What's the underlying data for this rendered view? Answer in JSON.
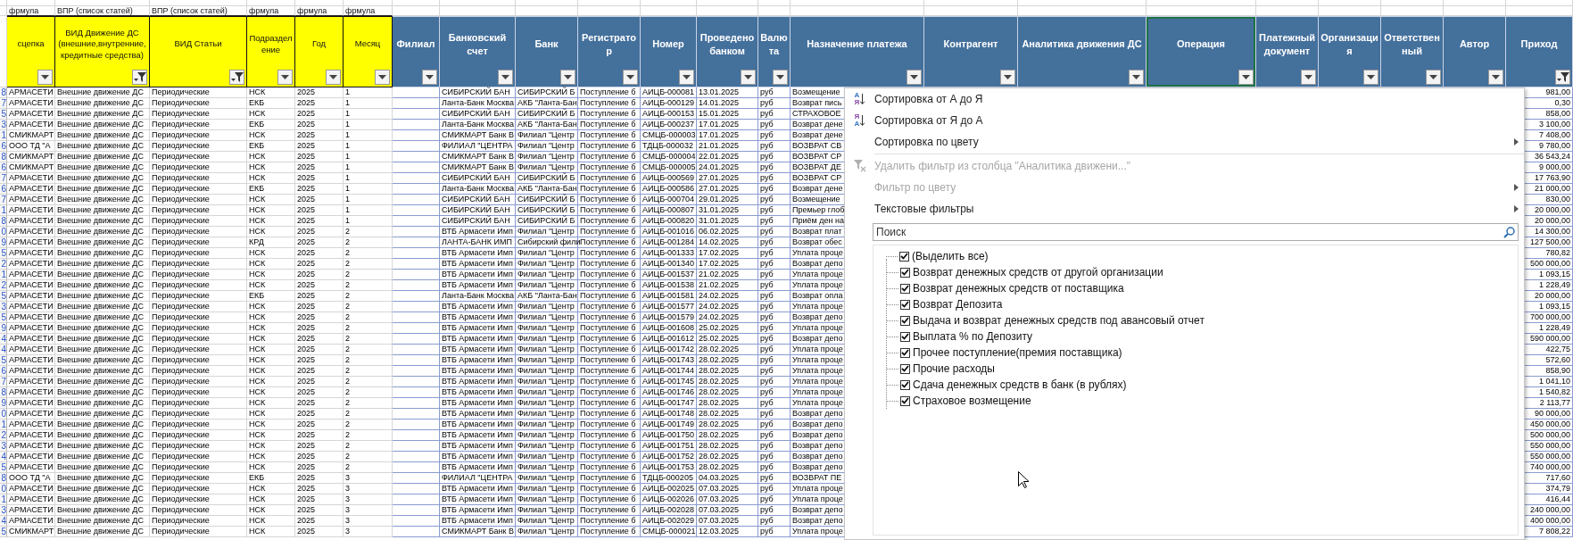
{
  "formula_labels": [
    "фрмула",
    "ВПР (список статей)",
    "ВПР (список статей)",
    "фрмула",
    "фрмула",
    "фрмула"
  ],
  "columns": [
    {
      "header": "сцепка",
      "color": "#ffff00",
      "filtered": false,
      "selected": false
    },
    {
      "header": "ВИД Движение ДС (внешние,внутренние, кредитные средства)",
      "color": "#ffff00",
      "filtered": true,
      "selected": false
    },
    {
      "header": "ВИД Статьи",
      "color": "#ffff00",
      "filtered": true,
      "selected": false
    },
    {
      "header": "Подразделение",
      "color": "#ffff00",
      "filtered": false,
      "selected": false
    },
    {
      "header": "Год",
      "color": "#ffff00",
      "filtered": false,
      "selected": false
    },
    {
      "header": "Месяц",
      "color": "#ffff00",
      "filtered": false,
      "selected": false
    },
    {
      "header": "Филиал",
      "color": "#44709c",
      "filtered": false,
      "selected": false
    },
    {
      "header": "Банковский счет",
      "color": "#44709c",
      "filtered": false,
      "selected": false
    },
    {
      "header": "Банк",
      "color": "#44709c",
      "filtered": false,
      "selected": false
    },
    {
      "header": "Регистратор",
      "color": "#44709c",
      "filtered": false,
      "selected": false
    },
    {
      "header": "Номер",
      "color": "#44709c",
      "filtered": false,
      "selected": false
    },
    {
      "header": "Проведено банком",
      "color": "#44709c",
      "filtered": false,
      "selected": false
    },
    {
      "header": "Валюта",
      "color": "#44709c",
      "filtered": false,
      "selected": false
    },
    {
      "header": "Назначение платежа",
      "color": "#44709c",
      "filtered": false,
      "selected": false
    },
    {
      "header": "Контрагент",
      "color": "#44709c",
      "filtered": false,
      "selected": false
    },
    {
      "header": "Аналитика движения ДС",
      "color": "#44709c",
      "filtered": false,
      "selected": false
    },
    {
      "header": "Операция",
      "color": "#44709c",
      "filtered": false,
      "selected": true
    },
    {
      "header": "Платежный документ",
      "color": "#44709c",
      "filtered": false,
      "selected": false
    },
    {
      "header": "Организация",
      "color": "#44709c",
      "filtered": false,
      "selected": false
    },
    {
      "header": "Ответственный",
      "color": "#44709c",
      "filtered": false,
      "selected": false
    },
    {
      "header": "Автор",
      "color": "#44709c",
      "filtered": false,
      "selected": false
    },
    {
      "header": "Приход",
      "color": "#44709c",
      "filtered": true,
      "selected": false
    }
  ],
  "rows": [
    {
      "row_tail": "8",
      "link": "АРМАСЕТИ",
      "movement_type": "Внешние движение ДС",
      "article_type": "Периодические",
      "division": "НСК",
      "year": "2025",
      "month": "1",
      "bank_account": "СИБИРСКИЙ БАН",
      "bank": "СИБИРСКИЙ Б",
      "registrar": "Поступление б",
      "number": "АИЦБ-000081",
      "bank_date": "13.01.2025",
      "currency": "руб",
      "purpose": "Возмещение",
      "income": "981,00"
    },
    {
      "row_tail": "7",
      "link": "АРМАСЕТИ",
      "movement_type": "Внешние движение ДС",
      "article_type": "Периодические",
      "division": "ЕКБ",
      "year": "2025",
      "month": "1",
      "bank_account": "Ланта-Банк Москва",
      "bank": "АКБ \"Ланта-Бан",
      "registrar": "Поступление б",
      "number": "АИЦБ-000129",
      "bank_date": "14.01.2025",
      "currency": "руб",
      "purpose": "Возврат пись",
      "income": "0,30"
    },
    {
      "row_tail": "5",
      "link": "АРМАСЕТИ",
      "movement_type": "Внешние движение ДС",
      "article_type": "Периодические",
      "division": "НСК",
      "year": "2025",
      "month": "1",
      "bank_account": "СИБИРСКИЙ БАН",
      "bank": "СИБИРСКИЙ Б",
      "registrar": "Поступление б",
      "number": "АИЦБ-000153",
      "bank_date": "15.01.2025",
      "currency": "руб",
      "purpose": "СТРАХОВОЕ",
      "income": "858,00"
    },
    {
      "row_tail": "3",
      "link": "АРМАСЕТИ",
      "movement_type": "Внешние движение ДС",
      "article_type": "Периодические",
      "division": "ЕКБ",
      "year": "2025",
      "month": "1",
      "bank_account": "Ланта-Банк Москва",
      "bank": "АКБ \"Ланта-Бан",
      "registrar": "Поступление б",
      "number": "АИЦБ-000237",
      "bank_date": "17.01.2025",
      "currency": "руб",
      "purpose": "Возврат дене",
      "income": "3 100,00"
    },
    {
      "row_tail": "1",
      "link": "СМИКМАРТ",
      "movement_type": "Внешние движение ДС",
      "article_type": "Периодические",
      "division": "НСК",
      "year": "2025",
      "month": "1",
      "bank_account": "СМИКМАРТ Банк В",
      "bank": "Филиал \"Центр",
      "registrar": "Поступление б",
      "number": "СМЦБ-000003",
      "bank_date": "17.01.2025",
      "currency": "руб",
      "purpose": "Возврат дене",
      "income": "7 408,00"
    },
    {
      "row_tail": "6",
      "link": "ООО ТД \"А",
      "movement_type": "Внешние движение ДС",
      "article_type": "Периодические",
      "division": "ЕКБ",
      "year": "2025",
      "month": "1",
      "bank_account": "ФИЛИАЛ \"ЦЕНТРА",
      "bank": "Филиал \"Центр",
      "registrar": "Поступление б",
      "number": "ТДЦБ-000032",
      "bank_date": "21.01.2025",
      "currency": "руб",
      "purpose": "ВОЗВРАТ СВ",
      "income": "9 780,00"
    },
    {
      "row_tail": "8",
      "link": "СМИКМАРТ",
      "movement_type": "Внешние движение ДС",
      "article_type": "Периодические",
      "division": "НСК",
      "year": "2025",
      "month": "1",
      "bank_account": "СМИКМАРТ Банк В",
      "bank": "Филиал \"Центр",
      "registrar": "Поступление б",
      "number": "СМЦБ-000004",
      "bank_date": "22.01.2025",
      "currency": "руб",
      "purpose": "ВОЗВРАТ СР",
      "income": "36 543,24"
    },
    {
      "row_tail": "6",
      "link": "СМИКМАРТ",
      "movement_type": "Внешние движение ДС",
      "article_type": "Периодические",
      "division": "НСК",
      "year": "2025",
      "month": "1",
      "bank_account": "СМИКМАРТ Банк В",
      "bank": "Филиал \"Центр",
      "registrar": "Поступление б",
      "number": "СМЦБ-000005",
      "bank_date": "24.01.2025",
      "currency": "руб",
      "purpose": "ВОЗВРАТ ДЕ",
      "income": "9 000,00"
    },
    {
      "row_tail": "7",
      "link": "АРМАСЕТИ",
      "movement_type": "Внешние движение ДС",
      "article_type": "Периодические",
      "division": "НСК",
      "year": "2025",
      "month": "1",
      "bank_account": "СИБИРСКИЙ БАН",
      "bank": "СИБИРСКИЙ Б",
      "registrar": "Поступление б",
      "number": "АИЦБ-000569",
      "bank_date": "27.01.2025",
      "currency": "руб",
      "purpose": "ВОЗВРАТ СР",
      "income": "17 763,90"
    },
    {
      "row_tail": "6",
      "link": "АРМАСЕТИ",
      "movement_type": "Внешние движение ДС",
      "article_type": "Периодические",
      "division": "ЕКБ",
      "year": "2025",
      "month": "1",
      "bank_account": "Ланта-Банк Москва",
      "bank": "АКБ \"Ланта-Бан",
      "registrar": "Поступление б",
      "number": "АИЦБ-000586",
      "bank_date": "27.01.2025",
      "currency": "руб",
      "purpose": "Возврат дене",
      "income": "21 000,00"
    },
    {
      "row_tail": "7",
      "link": "АРМАСЕТИ",
      "movement_type": "Внешние движение ДС",
      "article_type": "Периодические",
      "division": "НСК",
      "year": "2025",
      "month": "1",
      "bank_account": "СИБИРСКИЙ БАН",
      "bank": "СИБИРСКИЙ Б",
      "registrar": "Поступление б",
      "number": "АИЦБ-000704",
      "bank_date": "29.01.2025",
      "currency": "руб",
      "purpose": "Возмещение",
      "income": "830,00"
    },
    {
      "row_tail": "1",
      "link": "АРМАСЕТИ",
      "movement_type": "Внешние движение ДС",
      "article_type": "Периодические",
      "division": "НСК",
      "year": "2025",
      "month": "1",
      "bank_account": "СИБИРСКИЙ БАН",
      "bank": "СИБИРСКИЙ Б",
      "registrar": "Поступление б",
      "number": "АИЦБ-000807",
      "bank_date": "31.01.2025",
      "currency": "руб",
      "purpose": "Премьер глоб",
      "income": "20 000,00"
    },
    {
      "row_tail": "8",
      "link": "АРМАСЕТИ",
      "movement_type": "Внешние движение ДС",
      "article_type": "Периодические",
      "division": "НСК",
      "year": "2025",
      "month": "1",
      "bank_account": "СИБИРСКИЙ БАН",
      "bank": "СИБИРСКИЙ Б",
      "registrar": "Поступление б",
      "number": "АИЦБ-000820",
      "bank_date": "31.01.2025",
      "currency": "руб",
      "purpose": "Приём ден на",
      "income": "20 000,00"
    },
    {
      "row_tail": "0",
      "link": "АРМАСЕТИ",
      "movement_type": "Внешние движение ДС",
      "article_type": "Периодические",
      "division": "НСК",
      "year": "2025",
      "month": "2",
      "bank_account": "ВТБ Армасети Имп",
      "bank": "Филиал \"Центр",
      "registrar": "Поступление б",
      "number": "АИЦБ-001016",
      "bank_date": "06.02.2025",
      "currency": "руб",
      "purpose": "Возврат плат",
      "income": "14 300,00"
    },
    {
      "row_tail": "9",
      "link": "АРМАСЕТИ",
      "movement_type": "Внешние движение ДС",
      "article_type": "Периодические",
      "division": "КРД",
      "year": "2025",
      "month": "2",
      "bank_account": "ЛАНТА-БАНК ИМП",
      "bank": "Сибирский фили",
      "registrar": "Поступление б",
      "number": "АИЦБ-001284",
      "bank_date": "14.02.2025",
      "currency": "руб",
      "purpose": "Возврат обес",
      "income": "127 500,00"
    },
    {
      "row_tail": "5",
      "link": "АРМАСЕТИ",
      "movement_type": "Внешние движение ДС",
      "article_type": "Периодические",
      "division": "НСК",
      "year": "2025",
      "month": "2",
      "bank_account": "ВТБ Армасети Имп",
      "bank": "Филиал \"Центр",
      "registrar": "Поступление б",
      "number": "АИЦБ-001333",
      "bank_date": "17.02.2025",
      "currency": "руб",
      "purpose": "Уплата проце",
      "income": "780,82"
    },
    {
      "row_tail": "2",
      "link": "АРМАСЕТИ",
      "movement_type": "Внешние движение ДС",
      "article_type": "Периодические",
      "division": "НСК",
      "year": "2025",
      "month": "2",
      "bank_account": "ВТБ Армасети Имп",
      "bank": "Филиал \"Центр",
      "registrar": "Поступление б",
      "number": "АИЦБ-001340",
      "bank_date": "17.02.2025",
      "currency": "руб",
      "purpose": "Возврат депо",
      "income": "500 000,00"
    },
    {
      "row_tail": "1",
      "link": "АРМАСЕТИ",
      "movement_type": "Внешние движение ДС",
      "article_type": "Периодические",
      "division": "НСК",
      "year": "2025",
      "month": "2",
      "bank_account": "ВТБ Армасети Имп",
      "bank": "Филиал \"Центр",
      "registrar": "Поступление б",
      "number": "АИЦБ-001537",
      "bank_date": "21.02.2025",
      "currency": "руб",
      "purpose": "Уплата проце",
      "income": "1 093,15"
    },
    {
      "row_tail": "2",
      "link": "АРМАСЕТИ",
      "movement_type": "Внешние движение ДС",
      "article_type": "Периодические",
      "division": "НСК",
      "year": "2025",
      "month": "2",
      "bank_account": "ВТБ Армасети Имп",
      "bank": "Филиал \"Центр",
      "registrar": "Поступление б",
      "number": "АИЦБ-001538",
      "bank_date": "21.02.2025",
      "currency": "руб",
      "purpose": "Уплата проце",
      "income": "1 228,49"
    },
    {
      "row_tail": "5",
      "link": "АРМАСЕТИ",
      "movement_type": "Внешние движение ДС",
      "article_type": "Периодические",
      "division": "ЕКБ",
      "year": "2025",
      "month": "2",
      "bank_account": "Ланта-Банк Москва",
      "bank": "АКБ \"Ланта-Бан",
      "registrar": "Поступление б",
      "number": "АИЦБ-001581",
      "bank_date": "24.02.2025",
      "currency": "руб",
      "purpose": "Возврат опла",
      "income": "20 000,00"
    },
    {
      "row_tail": "3",
      "link": "АРМАСЕТИ",
      "movement_type": "Внешние движение ДС",
      "article_type": "Периодические",
      "division": "НСК",
      "year": "2025",
      "month": "2",
      "bank_account": "ВТБ Армасети Имп",
      "bank": "Филиал \"Центр",
      "registrar": "Поступление б",
      "number": "АИЦБ-001577",
      "bank_date": "24.02.2025",
      "currency": "руб",
      "purpose": "Уплата проце",
      "income": "1 093,15"
    },
    {
      "row_tail": "5",
      "link": "АРМАСЕТИ",
      "movement_type": "Внешние движение ДС",
      "article_type": "Периодические",
      "division": "НСК",
      "year": "2025",
      "month": "2",
      "bank_account": "ВТБ Армасети Имп",
      "bank": "Филиал \"Центр",
      "registrar": "Поступление б",
      "number": "АИЦБ-001579",
      "bank_date": "24.02.2025",
      "currency": "руб",
      "purpose": "Возврат депо",
      "income": "700 000,00"
    },
    {
      "row_tail": "9",
      "link": "АРМАСЕТИ",
      "movement_type": "Внешние движение ДС",
      "article_type": "Периодические",
      "division": "НСК",
      "year": "2025",
      "month": "2",
      "bank_account": "ВТБ Армасети Имп",
      "bank": "Филиал \"Центр",
      "registrar": "Поступление б",
      "number": "АИЦБ-001608",
      "bank_date": "25.02.2025",
      "currency": "руб",
      "purpose": "Уплата проце",
      "income": "1 228,49"
    },
    {
      "row_tail": "4",
      "link": "АРМАСЕТИ",
      "movement_type": "Внешние движение ДС",
      "article_type": "Периодические",
      "division": "НСК",
      "year": "2025",
      "month": "2",
      "bank_account": "ВТБ Армасети Имп",
      "bank": "Филиал \"Центр",
      "registrar": "Поступление б",
      "number": "АИЦБ-001612",
      "bank_date": "25.02.2025",
      "currency": "руб",
      "purpose": "Возврат депо",
      "income": "590 000,00"
    },
    {
      "row_tail": "4",
      "link": "АРМАСЕТИ",
      "movement_type": "Внешние движение ДС",
      "article_type": "Периодические",
      "division": "НСК",
      "year": "2025",
      "month": "2",
      "bank_account": "ВТБ Армасети Имп",
      "bank": "Филиал \"Центр",
      "registrar": "Поступление б",
      "number": "АИЦБ-001742",
      "bank_date": "28.02.2025",
      "currency": "руб",
      "purpose": "Уплата проце",
      "income": "422,75"
    },
    {
      "row_tail": "5",
      "link": "АРМАСЕТИ",
      "movement_type": "Внешние движение ДС",
      "article_type": "Периодические",
      "division": "НСК",
      "year": "2025",
      "month": "2",
      "bank_account": "ВТБ Армасети Имп",
      "bank": "Филиал \"Центр",
      "registrar": "Поступление б",
      "number": "АИЦБ-001743",
      "bank_date": "28.02.2025",
      "currency": "руб",
      "purpose": "Уплата проце",
      "income": "572,60"
    },
    {
      "row_tail": "6",
      "link": "АРМАСЕТИ",
      "movement_type": "Внешние движение ДС",
      "article_type": "Периодические",
      "division": "НСК",
      "year": "2025",
      "month": "2",
      "bank_account": "ВТБ Армасети Имп",
      "bank": "Филиал \"Центр",
      "registrar": "Поступление б",
      "number": "АИЦБ-001744",
      "bank_date": "28.02.2025",
      "currency": "руб",
      "purpose": "Уплата проце",
      "income": "858,90"
    },
    {
      "row_tail": "7",
      "link": "АРМАСЕТИ",
      "movement_type": "Внешние движение ДС",
      "article_type": "Периодические",
      "division": "НСК",
      "year": "2025",
      "month": "2",
      "bank_account": "ВТБ Армасети Имп",
      "bank": "Филиал \"Центр",
      "registrar": "Поступление б",
      "number": "АИЦБ-001745",
      "bank_date": "28.02.2025",
      "currency": "руб",
      "purpose": "Уплата проце",
      "income": "1 041,10"
    },
    {
      "row_tail": "8",
      "link": "АРМАСЕТИ",
      "movement_type": "Внешние движение ДС",
      "article_type": "Периодические",
      "division": "НСК",
      "year": "2025",
      "month": "2",
      "bank_account": "ВТБ Армасети Имп",
      "bank": "Филиал \"Центр",
      "registrar": "Поступление б",
      "number": "АИЦБ-001746",
      "bank_date": "28.02.2025",
      "currency": "руб",
      "purpose": "Уплата проце",
      "income": "1 540,82"
    },
    {
      "row_tail": "9",
      "link": "АРМАСЕТИ",
      "movement_type": "Внешние движение ДС",
      "article_type": "Периодические",
      "division": "НСК",
      "year": "2025",
      "month": "2",
      "bank_account": "ВТБ Армасети Имп",
      "bank": "Филиал \"Центр",
      "registrar": "Поступление б",
      "number": "АИЦБ-001747",
      "bank_date": "28.02.2025",
      "currency": "руб",
      "purpose": "Уплата проце",
      "income": "2 113,77"
    },
    {
      "row_tail": "0",
      "link": "АРМАСЕТИ",
      "movement_type": "Внешние движение ДС",
      "article_type": "Периодические",
      "division": "НСК",
      "year": "2025",
      "month": "2",
      "bank_account": "ВТБ Армасети Имп",
      "bank": "Филиал \"Центр",
      "registrar": "Поступление б",
      "number": "АИЦБ-001748",
      "bank_date": "28.02.2025",
      "currency": "руб",
      "purpose": "Возврат депо",
      "income": "90 000,00"
    },
    {
      "row_tail": "1",
      "link": "АРМАСЕТИ",
      "movement_type": "Внешние движение ДС",
      "article_type": "Периодические",
      "division": "НСК",
      "year": "2025",
      "month": "2",
      "bank_account": "ВТБ Армасети Имп",
      "bank": "Филиал \"Центр",
      "registrar": "Поступление б",
      "number": "АИЦБ-001749",
      "bank_date": "28.02.2025",
      "currency": "руб",
      "purpose": "Возврат депо",
      "income": "450 000,00"
    },
    {
      "row_tail": "2",
      "link": "АРМАСЕТИ",
      "movement_type": "Внешние движение ДС",
      "article_type": "Периодические",
      "division": "НСК",
      "year": "2025",
      "month": "2",
      "bank_account": "ВТБ Армасети Имп",
      "bank": "Филиал \"Центр",
      "registrar": "Поступление б",
      "number": "АИЦБ-001750",
      "bank_date": "28.02.2025",
      "currency": "руб",
      "purpose": "Возврат депо",
      "income": "500 000,00"
    },
    {
      "row_tail": "3",
      "link": "АРМАСЕТИ",
      "movement_type": "Внешние движение ДС",
      "article_type": "Периодические",
      "division": "НСК",
      "year": "2025",
      "month": "2",
      "bank_account": "ВТБ Армасети Имп",
      "bank": "Филиал \"Центр",
      "registrar": "Поступление б",
      "number": "АИЦБ-001751",
      "bank_date": "28.02.2025",
      "currency": "руб",
      "purpose": "Возврат депо",
      "income": "550 000,00"
    },
    {
      "row_tail": "4",
      "link": "АРМАСЕТИ",
      "movement_type": "Внешние движение ДС",
      "article_type": "Периодические",
      "division": "НСК",
      "year": "2025",
      "month": "2",
      "bank_account": "ВТБ Армасети Имп",
      "bank": "Филиал \"Центр",
      "registrar": "Поступление б",
      "number": "АИЦБ-001752",
      "bank_date": "28.02.2025",
      "currency": "руб",
      "purpose": "Возврат депо",
      "income": "550 000,00"
    },
    {
      "row_tail": "5",
      "link": "АРМАСЕТИ",
      "movement_type": "Внешние движение ДС",
      "article_type": "Периодические",
      "division": "НСК",
      "year": "2025",
      "month": "2",
      "bank_account": "ВТБ Армасети Имп",
      "bank": "Филиал \"Центр",
      "registrar": "Поступление б",
      "number": "АИЦБ-001753",
      "bank_date": "28.02.2025",
      "currency": "руб",
      "purpose": "Возврат депо",
      "income": "740 000,00"
    },
    {
      "row_tail": "8",
      "link": "ООО ТД \"А",
      "movement_type": "Внешние движение ДС",
      "article_type": "Периодические",
      "division": "ЕКБ",
      "year": "2025",
      "month": "3",
      "bank_account": "ФИЛИАЛ \"ЦЕНТРА",
      "bank": "Филиал \"Центр",
      "registrar": "Поступление б",
      "number": "ТДЦБ-000205",
      "bank_date": "04.03.2025",
      "currency": "руб",
      "purpose": "ВОЗВРАТ ПЕ",
      "income": "717,60"
    },
    {
      "row_tail": "0",
      "link": "АРМАСЕТИ",
      "movement_type": "Внешние движение ДС",
      "article_type": "Периодические",
      "division": "НСК",
      "year": "2025",
      "month": "3",
      "bank_account": "ВТБ Армасети Имп",
      "bank": "Филиал \"Центр",
      "registrar": "Поступление б",
      "number": "АИЦБ-002025",
      "bank_date": "07.03.2025",
      "currency": "руб",
      "purpose": "Уплата проце",
      "income": "374,79"
    },
    {
      "row_tail": "1",
      "link": "АРМАСЕТИ",
      "movement_type": "Внешние движение ДС",
      "article_type": "Периодические",
      "division": "НСК",
      "year": "2025",
      "month": "3",
      "bank_account": "ВТБ Армасети Имп",
      "bank": "Филиал \"Центр",
      "registrar": "Поступление б",
      "number": "АИЦБ-002026",
      "bank_date": "07.03.2025",
      "currency": "руб",
      "purpose": "Уплата проце",
      "income": "416,44"
    },
    {
      "row_tail": "3",
      "link": "АРМАСЕТИ",
      "movement_type": "Внешние движение ДС",
      "article_type": "Периодические",
      "division": "НСК",
      "year": "2025",
      "month": "3",
      "bank_account": "ВТБ Армасети Имп",
      "bank": "Филиал \"Центр",
      "registrar": "Поступление б",
      "number": "АИЦБ-002028",
      "bank_date": "07.03.2025",
      "currency": "руб",
      "purpose": "Возврат депо",
      "income": "240 000,00"
    },
    {
      "row_tail": "4",
      "link": "АРМАСЕТИ",
      "movement_type": "Внешние движение ДС",
      "article_type": "Периодические",
      "division": "НСК",
      "year": "2025",
      "month": "3",
      "bank_account": "ВТБ Армасети Имп",
      "bank": "Филиал \"Центр",
      "registrar": "Поступление б",
      "number": "АИЦБ-002029",
      "bank_date": "07.03.2025",
      "currency": "руб",
      "purpose": "Возврат депо",
      "income": "400 000,00"
    },
    {
      "row_tail": "5",
      "link": "СМИКМАРТ",
      "movement_type": "Внешние движение ДС",
      "article_type": "Периодические",
      "division": "НСК",
      "year": "2025",
      "month": "3",
      "bank_account": "СМИКМАРТ Банк В",
      "bank": "Филиал \"Центр",
      "registrar": "Поступление б",
      "number": "СМЦБ-000021",
      "bank_date": "12.03.2025",
      "currency": "руб",
      "purpose": "Уплата проце",
      "income": "7 808,22"
    }
  ],
  "filter_menu": {
    "sort_items": [
      {
        "label": "Сортировка от А до Я",
        "kind": "sort_ascending",
        "icon_letters": [
          "А",
          "Я"
        ],
        "disabled": false,
        "submenu": false
      },
      {
        "label": "Сортировка от Я до А",
        "kind": "sort_descending",
        "icon_letters": [
          "Я",
          "А"
        ],
        "disabled": false,
        "submenu": false
      },
      {
        "label": "Сортировка по цвету",
        "kind": "plain",
        "disabled": false,
        "submenu": true
      }
    ],
    "filter_items": [
      {
        "label": "Удалить фильтр из столбца \"Аналитика движени...\"",
        "kind": "clear_filter",
        "disabled": true,
        "submenu": false
      },
      {
        "label": "Фильтр по цвету",
        "kind": "plain",
        "disabled": true,
        "submenu": true
      },
      {
        "label": "Текстовые фильтры",
        "kind": "plain",
        "disabled": false,
        "submenu": true
      }
    ],
    "search": {
      "placeholder": "Поиск"
    },
    "values": [
      {
        "label": "(Выделить все)",
        "checked": true,
        "children": [
          {
            "label": "Возврат денежных средств от другой организации",
            "checked": true
          },
          {
            "label": "Возврат денежных средств от поставщика",
            "checked": true
          },
          {
            "label": "Возврат Депозита",
            "checked": true
          },
          {
            "label": "Выдача и возврат денежных средств под авансовый отчет",
            "checked": true
          },
          {
            "label": "Выплата % по Депозиту",
            "checked": true
          },
          {
            "label": "Прочее поступление(премия поставщика)",
            "checked": true
          },
          {
            "label": "Прочие расходы",
            "checked": true
          },
          {
            "label": "Сдача денежных средств в банк (в рублях)",
            "checked": true
          },
          {
            "label": "Страховое возмещение",
            "checked": true
          }
        ]
      }
    ]
  }
}
